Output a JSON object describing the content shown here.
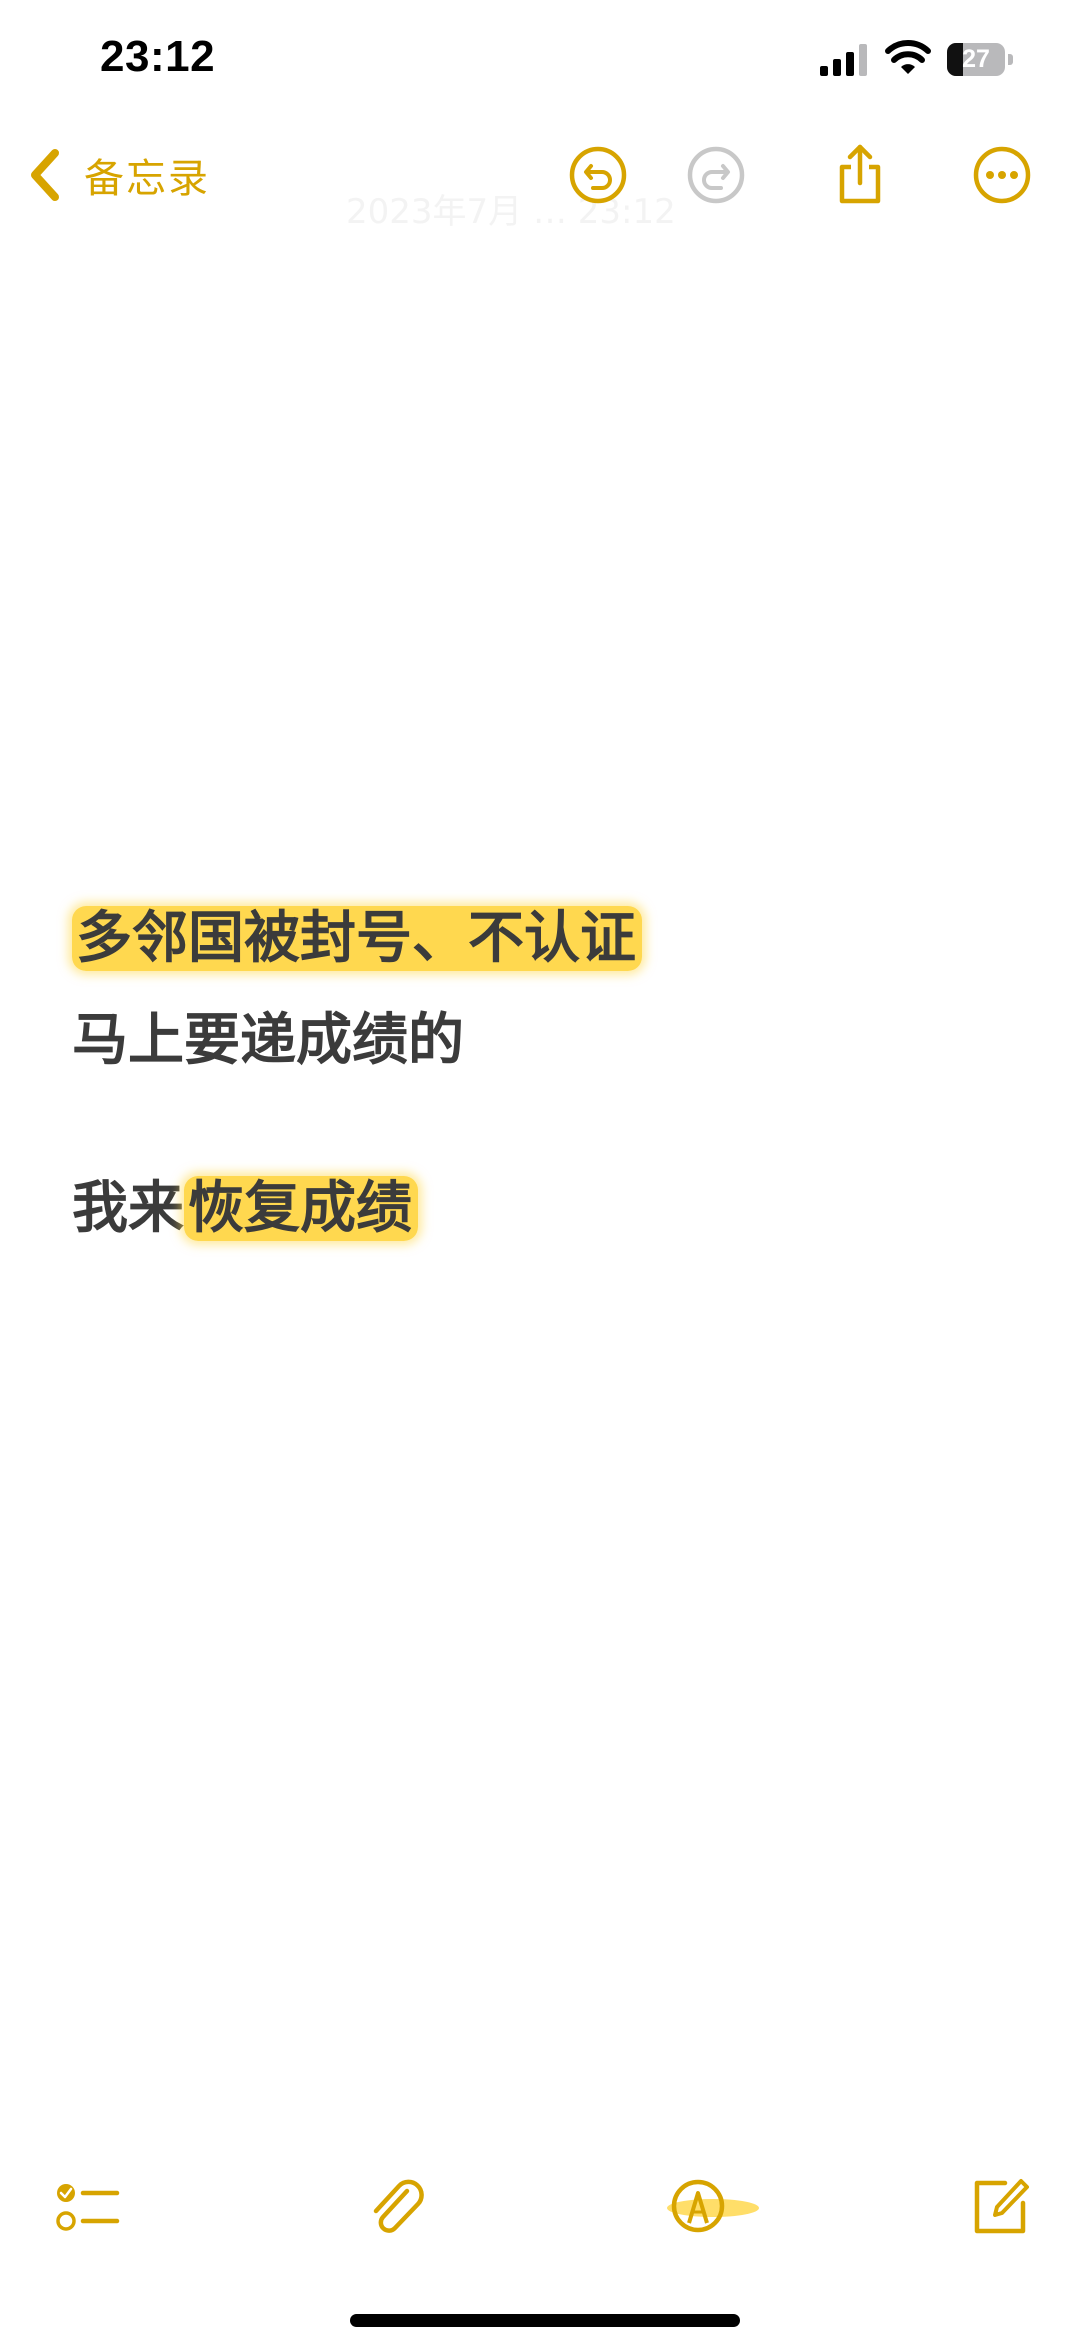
{
  "status_bar": {
    "time": "23:12",
    "battery_level": 27,
    "battery_text": "27",
    "icons": [
      "signal-icon",
      "wifi-icon",
      "battery-icon"
    ]
  },
  "nav": {
    "back_label": "备忘录",
    "faded_date": "2023年7月 … 23:12",
    "icons": [
      "chevron-left-icon",
      "undo-icon",
      "redo-icon",
      "share-icon",
      "more-icon"
    ]
  },
  "note": {
    "line1_highlight": "多邻国被封号、不认证",
    "line2": "马上要递成绩的",
    "line3_plain": "我来",
    "line3_highlight": "恢复成绩"
  },
  "toolbar": {
    "icons": [
      "checklist-icon",
      "paperclip-icon",
      "markup-pen-icon",
      "compose-icon"
    ]
  },
  "colors": {
    "accent": "#d7a400",
    "highlight": "#ffd84f",
    "text": "#3b3b3b",
    "disabled_icon": "#c8c8c8"
  }
}
